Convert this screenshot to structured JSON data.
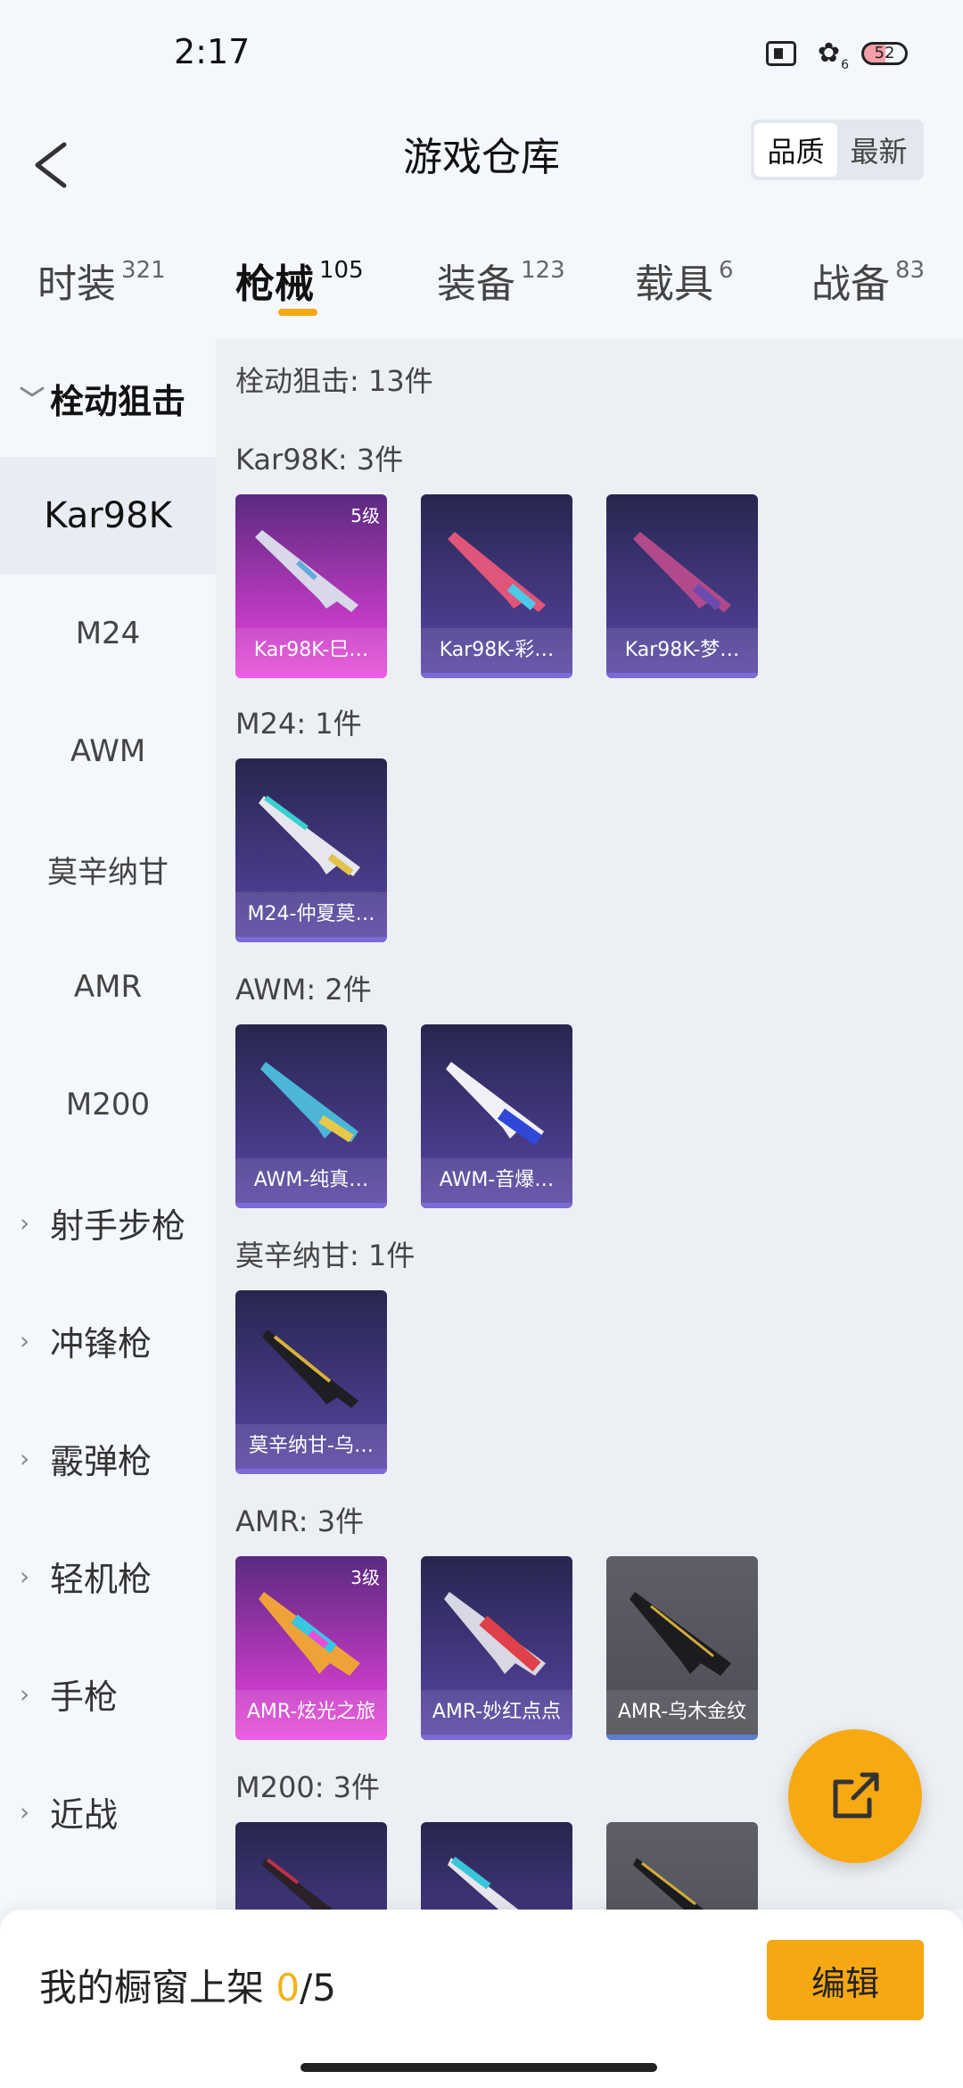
{
  "status_bar": {
    "time": "2:17",
    "wifi_sub": "6",
    "battery": "52"
  },
  "header": {
    "title": "游戏仓库",
    "sort_options": [
      "品质",
      "最新"
    ]
  },
  "tabs": [
    {
      "label": "时装",
      "count": "321"
    },
    {
      "label": "枪械",
      "count": "105"
    },
    {
      "label": "装备",
      "count": "123"
    },
    {
      "label": "载具",
      "count": "6"
    },
    {
      "label": "战备",
      "count": "83"
    }
  ],
  "sidebar": {
    "open_category": "栓动狙击",
    "sub_items": [
      "Kar98K",
      "M24",
      "AWM",
      "莫辛纳甘",
      "AMR",
      "M200"
    ],
    "categories": [
      "射手步枪",
      "冲锋枪",
      "霰弹枪",
      "轻机枪",
      "手枪",
      "近战"
    ]
  },
  "main": {
    "total": "栓动狙击: 13件",
    "sections": [
      {
        "title": "Kar98K: 3件",
        "items": [
          {
            "name": "Kar98K-巳…",
            "level": "5级"
          },
          {
            "name": "Kar98K-彩…"
          },
          {
            "name": "Kar98K-梦…"
          }
        ]
      },
      {
        "title": "M24: 1件",
        "items": [
          {
            "name": "M24-仲夏莫…"
          }
        ]
      },
      {
        "title": "AWM: 2件",
        "items": [
          {
            "name": "AWM-纯真…"
          },
          {
            "name": "AWM-音爆…"
          }
        ]
      },
      {
        "title": "莫辛纳甘: 1件",
        "items": [
          {
            "name": "莫辛纳甘-乌…"
          }
        ]
      },
      {
        "title": "AMR: 3件",
        "items": [
          {
            "name": "AMR-炫光之旅",
            "level": "3级"
          },
          {
            "name": "AMR-妙红点点"
          },
          {
            "name": "AMR-乌木金纹"
          }
        ]
      },
      {
        "title": "M200: 3件"
      }
    ]
  },
  "bottom": {
    "shelf_label": "我的橱窗上架",
    "shelf_current": "0",
    "shelf_total": "/5",
    "edit_label": "编辑"
  },
  "colors": {
    "accent": "#f6a812",
    "pink_card": "#c43bc5",
    "purple_card": "#4a3c8c",
    "gray_card": "#55565d"
  }
}
